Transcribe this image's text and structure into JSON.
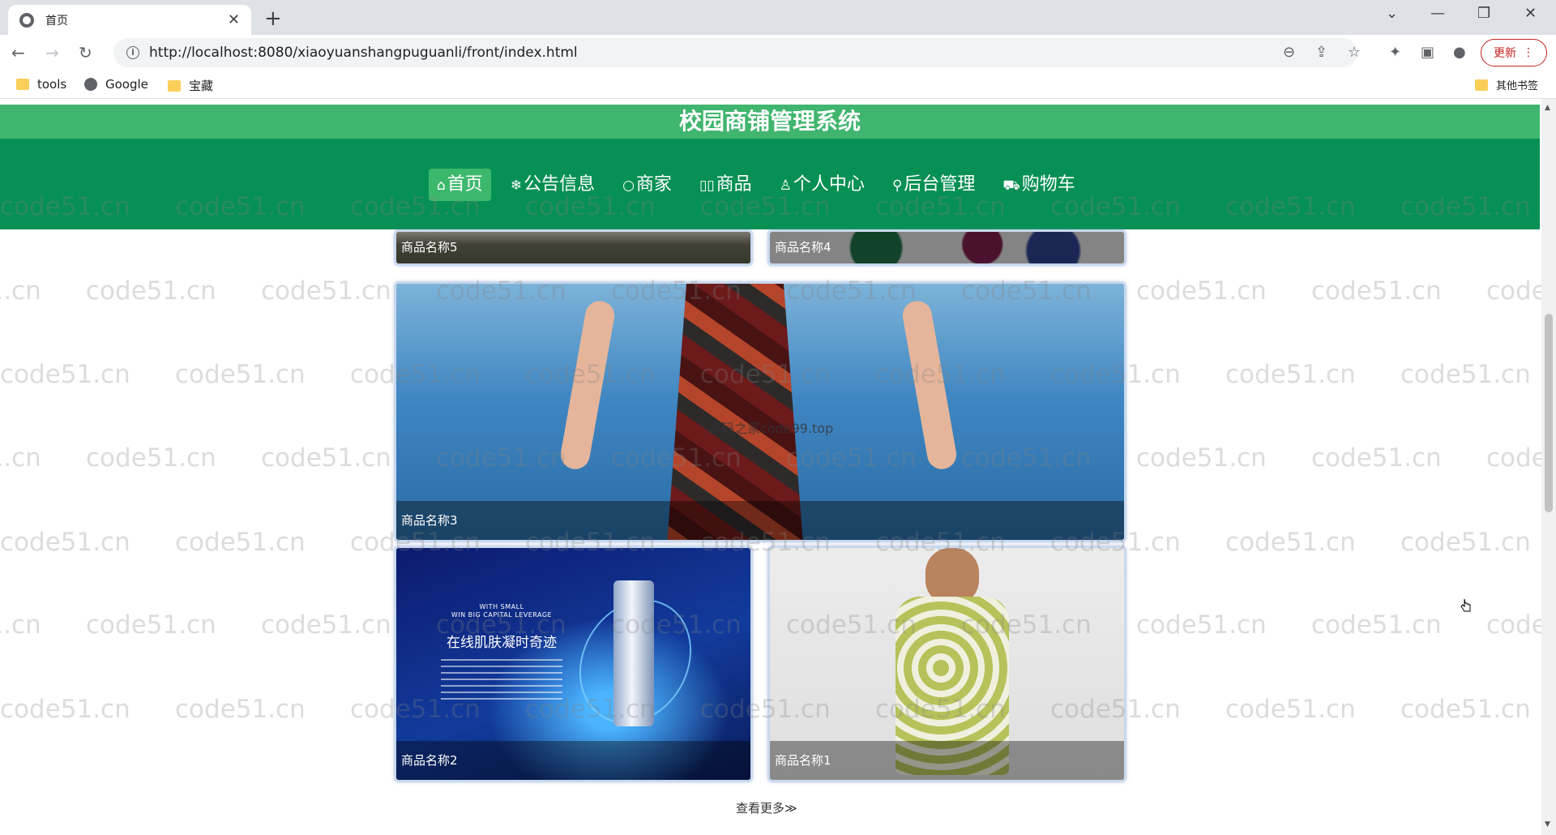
{
  "browser": {
    "tab_title": "首页",
    "tab_close": "✕",
    "new_tab": "+",
    "url": "http://localhost:8080/xiaoyuanshangpuguanli/front/index.html",
    "update_label": "更新",
    "bookmarks": [
      "tools",
      "Google",
      "宝藏"
    ],
    "other_bookmarks": "其他书签",
    "window_controls": [
      "⌄",
      "—",
      "❐",
      "✕"
    ],
    "nav_glyphs": {
      "back": "←",
      "forward": "→",
      "reload": "↻"
    },
    "toolbar_glyphs": {
      "zoom": "⊖",
      "share": "⇪",
      "star": "☆",
      "extensions": "✦",
      "sidepanel": "▣",
      "profile": "●",
      "menu": "⋮"
    }
  },
  "site": {
    "title": "校园商铺管理系统",
    "nav": [
      {
        "icon": "⌂",
        "label": "首页",
        "active": true
      },
      {
        "icon": "❄",
        "label": "公告信息"
      },
      {
        "icon": "○",
        "label": "商家"
      },
      {
        "icon": "▯▯",
        "label": "商品"
      },
      {
        "icon": "♙",
        "label": "个人中心"
      },
      {
        "icon": "⚲",
        "label": "后台管理"
      },
      {
        "icon": "⛟",
        "label": "购物车"
      }
    ]
  },
  "products": [
    {
      "name": "商品名称5"
    },
    {
      "name": "商品名称4"
    },
    {
      "name": "商品名称3"
    },
    {
      "name": "商品名称2"
    },
    {
      "name": "商品名称1"
    }
  ],
  "image_watermark": "源码之家code99.top",
  "ad": {
    "small_lines": "WITH SMALL\nWIN BIG CAPITAL LEVERAGE",
    "headline": "在线肌肤凝时奇迹"
  },
  "more_label": "查看更多≫",
  "watermark": "code51.cn",
  "colors": {
    "header": "#40b56e",
    "navbar": "#079054",
    "nav_active": "#3cb86d"
  }
}
